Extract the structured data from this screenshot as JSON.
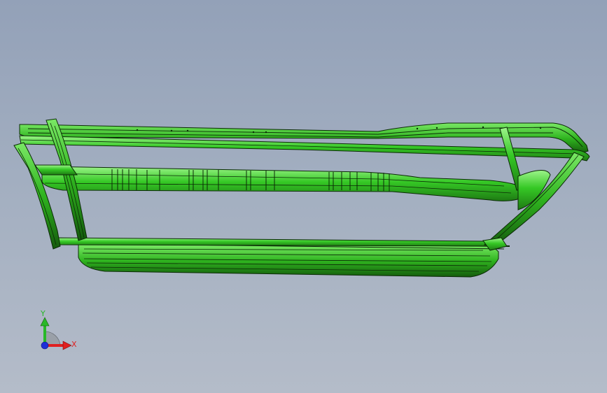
{
  "view": {
    "background_top": "#93a1b8",
    "background_bottom": "#b4bcc9"
  },
  "model": {
    "color": "#35c825",
    "edge_color": "#0b2a06",
    "highlight_color": "#9df48a"
  },
  "triad": {
    "x_label": "X",
    "y_label": "Y",
    "x_color": "#e02020",
    "y_color": "#28b828",
    "z_color": "#1f2fd8"
  }
}
